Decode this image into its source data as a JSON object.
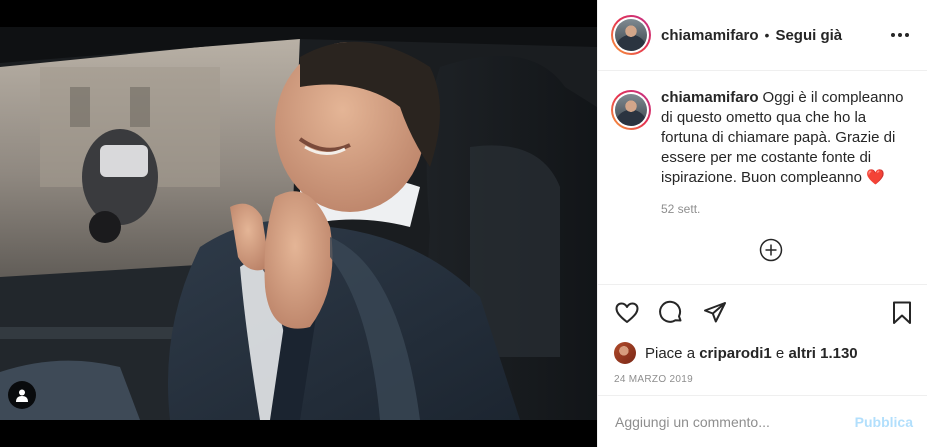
{
  "post": {
    "username": "chiamamifaro",
    "separator": "•",
    "follow_status": "Segui già",
    "caption_username": "chiamamifaro",
    "caption_text": "Oggi è il compleanno di questo ometto qua che ho la fortuna di chiamare papà. Grazie di essere per me costante fonte di ispirazione. Buon compleanno",
    "caption_emoji": "❤️",
    "caption_age": "52 sett.",
    "likes_prefix": "Piace a",
    "likes_user": "criparodi1",
    "likes_conj": "e",
    "likes_others": "altri 1.130",
    "date": "24 MARZO 2019"
  },
  "comment_box": {
    "placeholder": "Aggiungi un commento...",
    "publish_label": "Pubblica"
  },
  "icons": {
    "more": "more-options-icon",
    "load_more": "plus-circle-icon",
    "like": "heart-icon",
    "comment": "comment-icon",
    "share": "share-icon",
    "save": "bookmark-icon",
    "user_tag": "user-tag-icon"
  },
  "colors": {
    "text": "#262626",
    "secondary": "#8e8e8e",
    "publish_disabled": "#b2dffc",
    "story_ring_start": "#f9a23a",
    "story_ring_end": "#c02e8c"
  }
}
